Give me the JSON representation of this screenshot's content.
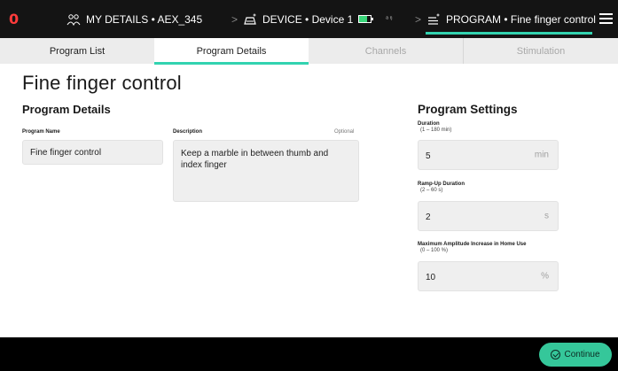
{
  "topbar": {
    "logo": "0",
    "my_details": "MY DETAILS • AEX_345",
    "device": "DEVICE • Device 1",
    "program": "PROGRAM • Fine finger control",
    "signal_text": "ᵃ ᵑ",
    "separator": ">"
  },
  "tabs": [
    {
      "label": "Program List"
    },
    {
      "label": "Program Details"
    },
    {
      "label": "Channels"
    },
    {
      "label": "Stimulation"
    }
  ],
  "page": {
    "title": "Fine finger control"
  },
  "details": {
    "heading": "Program Details",
    "name_label": "Program Name",
    "name_value": "Fine finger control",
    "desc_label": "Description",
    "desc_optional": "Optional",
    "desc_value": "Keep a marble in between thumb and index finger"
  },
  "settings": {
    "heading": "Program Settings",
    "duration_label": "Duration",
    "duration_range": "(1 – 180 min)",
    "duration_value": "5",
    "duration_unit": "min",
    "ramp_label": "Ramp-Up Duration",
    "ramp_range": "(2 – 60 s)",
    "ramp_value": "2",
    "ramp_unit": "s",
    "amp_label": "Maximum Amplitude Increase in Home Use",
    "amp_range": "(0 – 100 %)",
    "amp_value": "10",
    "amp_unit": "%"
  },
  "footer": {
    "continue_label": "Continue"
  },
  "colors": {
    "accent": "#32d3b0",
    "button": "#35c79a",
    "logo": "#ff3b3b",
    "battery": "#3ad67a",
    "topbar": "#141414"
  }
}
